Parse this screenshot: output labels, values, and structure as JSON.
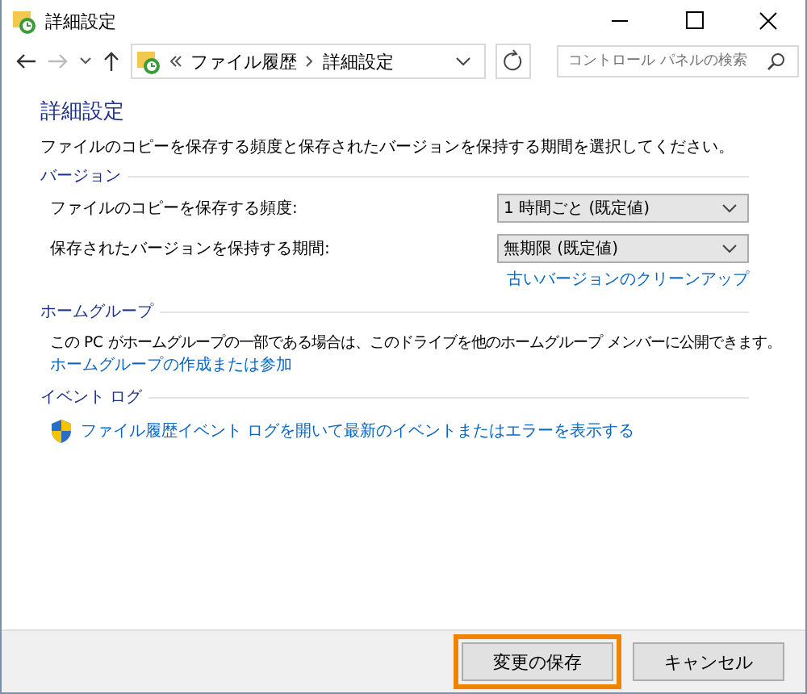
{
  "window": {
    "title": "詳細設定"
  },
  "address_bar": {
    "crumbs": [
      "ファイル履歴",
      "詳細設定"
    ]
  },
  "search": {
    "placeholder": "コントロール パネルの検索"
  },
  "heading": "詳細設定",
  "description": "ファイルのコピーを保存する頻度と保存されたバージョンを保持する期間を選択してください。",
  "sections": [
    {
      "kind": "settings",
      "title": "バージョン",
      "rows": [
        {
          "label": "ファイルのコピーを保存する頻度:",
          "value": "1 時間ごと (既定値)"
        },
        {
          "label": "保存されたバージョンを保持する期間:",
          "value": "無期限 (既定値)"
        }
      ],
      "link": "古いバージョンのクリーンアップ"
    },
    {
      "kind": "text",
      "title": "ホームグループ",
      "text": "この PC がホームグループの一部である場合は、このドライブを他のホームグループ メンバーに公開できます。",
      "link": "ホームグループの作成または参加"
    },
    {
      "kind": "shield",
      "title": "イベント ログ",
      "link": "ファイル履歴イベント ログを開いて最新のイベントまたはエラーを表示する"
    }
  ],
  "buttons": [
    {
      "label": "変更の保存",
      "highlighted": true
    },
    {
      "label": "キャンセル",
      "highlighted": false
    }
  ]
}
